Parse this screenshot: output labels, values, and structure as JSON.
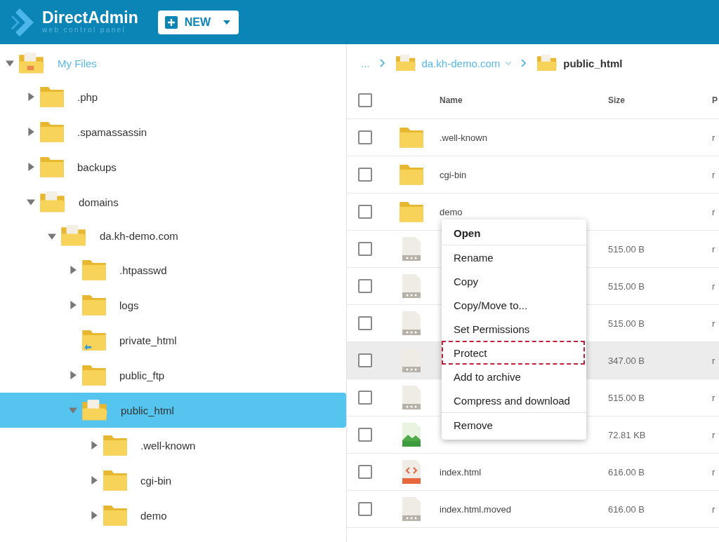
{
  "header": {
    "logo_title": "DirectAdmin",
    "logo_subtitle": "web control panel",
    "new_button": "NEW"
  },
  "tree": [
    {
      "label": "My Files",
      "kind": "home",
      "expanded": true,
      "selected": false,
      "children": [
        {
          "label": ".php",
          "kind": "folder",
          "expanded": false,
          "selected": false
        },
        {
          "label": ".spamassassin",
          "kind": "folder",
          "expanded": false,
          "selected": false
        },
        {
          "label": "backups",
          "kind": "folder",
          "expanded": false,
          "selected": false
        },
        {
          "label": "domains",
          "kind": "open",
          "expanded": true,
          "selected": false,
          "children": [
            {
              "label": "da.kh-demo.com",
              "kind": "open",
              "expanded": true,
              "selected": false,
              "children": [
                {
                  "label": ".htpasswd",
                  "kind": "folder",
                  "expanded": false,
                  "selected": false
                },
                {
                  "label": "logs",
                  "kind": "folder",
                  "expanded": false,
                  "selected": false
                },
                {
                  "label": "private_html",
                  "kind": "linked",
                  "expanded": false,
                  "selected": false
                },
                {
                  "label": "public_ftp",
                  "kind": "folder",
                  "expanded": false,
                  "selected": false
                },
                {
                  "label": "public_html",
                  "kind": "open",
                  "expanded": true,
                  "selected": true,
                  "children": [
                    {
                      "label": ".well-known",
                      "kind": "folder",
                      "expanded": false,
                      "selected": false
                    },
                    {
                      "label": "cgi-bin",
                      "kind": "folder",
                      "expanded": false,
                      "selected": false
                    },
                    {
                      "label": "demo",
                      "kind": "folder",
                      "expanded": false,
                      "selected": false
                    }
                  ]
                }
              ]
            }
          ]
        }
      ]
    }
  ],
  "breadcrumb": [
    {
      "label": "...",
      "kind": "ellipsis"
    },
    {
      "label": "da.kh-demo.com",
      "kind": "dropdown"
    },
    {
      "label": "public_html",
      "kind": "current"
    }
  ],
  "table": {
    "select_all_checked": false,
    "columns": [
      "Name",
      "Size",
      "P"
    ],
    "rows": [
      {
        "kind": "folder",
        "name": ".well-known",
        "size": "",
        "column_3": "r",
        "checked": false,
        "hovered": false
      },
      {
        "kind": "folder",
        "name": "cgi-bin",
        "size": "",
        "column_3": "r",
        "checked": false,
        "hovered": false
      },
      {
        "kind": "folder",
        "name": "demo",
        "size": "",
        "column_3": "r",
        "checked": false,
        "hovered": false
      },
      {
        "kind": "file",
        "name": "",
        "size": "515.00 B",
        "column_3": "r",
        "checked": false,
        "hovered": false
      },
      {
        "kind": "file",
        "name": "",
        "size": "515.00 B",
        "column_3": "r",
        "checked": false,
        "hovered": false
      },
      {
        "kind": "file",
        "name": "",
        "size": "515.00 B",
        "column_3": "r",
        "checked": false,
        "hovered": false
      },
      {
        "kind": "file",
        "name": "",
        "size": "347.00 B",
        "column_3": "r",
        "checked": false,
        "hovered": true
      },
      {
        "kind": "file",
        "name": "",
        "size": "515.00 B",
        "column_3": "r",
        "checked": false,
        "hovered": false
      },
      {
        "kind": "image",
        "name": "",
        "size": "72.81 KB",
        "column_3": "r",
        "checked": false,
        "hovered": false
      },
      {
        "kind": "html",
        "name": "index.html",
        "size": "616.00 B",
        "column_3": "r",
        "checked": false,
        "hovered": false
      },
      {
        "kind": "file",
        "name": "index.html.moved",
        "size": "616.00 B",
        "column_3": "r",
        "checked": false,
        "hovered": false
      }
    ]
  },
  "context_menu": [
    {
      "label": "Open",
      "bold": true,
      "divider_after": true,
      "highlighted": false
    },
    {
      "label": "Rename",
      "bold": false,
      "divider_after": false,
      "highlighted": false
    },
    {
      "label": "Copy",
      "bold": false,
      "divider_after": false,
      "highlighted": false
    },
    {
      "label": "Copy/Move to...",
      "bold": false,
      "divider_after": false,
      "highlighted": false
    },
    {
      "label": "Set Permissions",
      "bold": false,
      "divider_after": false,
      "highlighted": false
    },
    {
      "label": "Protect",
      "bold": false,
      "divider_after": false,
      "highlighted": true
    },
    {
      "label": "Add to archive",
      "bold": false,
      "divider_after": false,
      "highlighted": false
    },
    {
      "label": "Compress and download",
      "bold": false,
      "divider_after": true,
      "highlighted": false
    },
    {
      "label": "Remove",
      "bold": false,
      "divider_after": false,
      "highlighted": false
    }
  ]
}
